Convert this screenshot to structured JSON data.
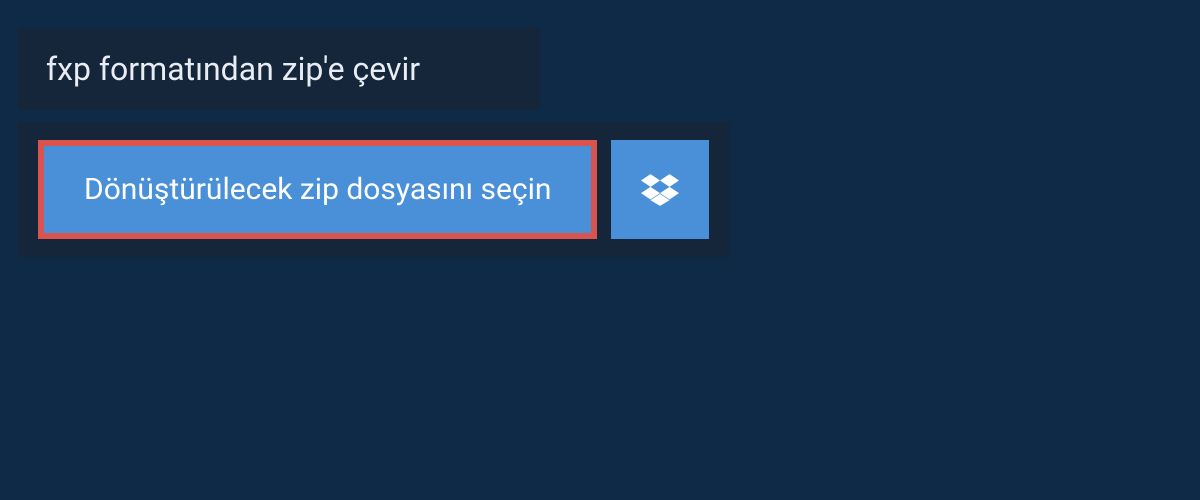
{
  "title": "fxp formatından zip'e çevir",
  "upload": {
    "select_file_label": "Dönüştürülecek zip dosyasını seçin",
    "dropbox_icon": "dropbox-icon"
  },
  "colors": {
    "page_bg": "#0e2a47",
    "panel_bg": "#15253a",
    "button_bg": "#4a90d9",
    "highlight_border": "#d9534f",
    "text_light": "#ffffff"
  }
}
